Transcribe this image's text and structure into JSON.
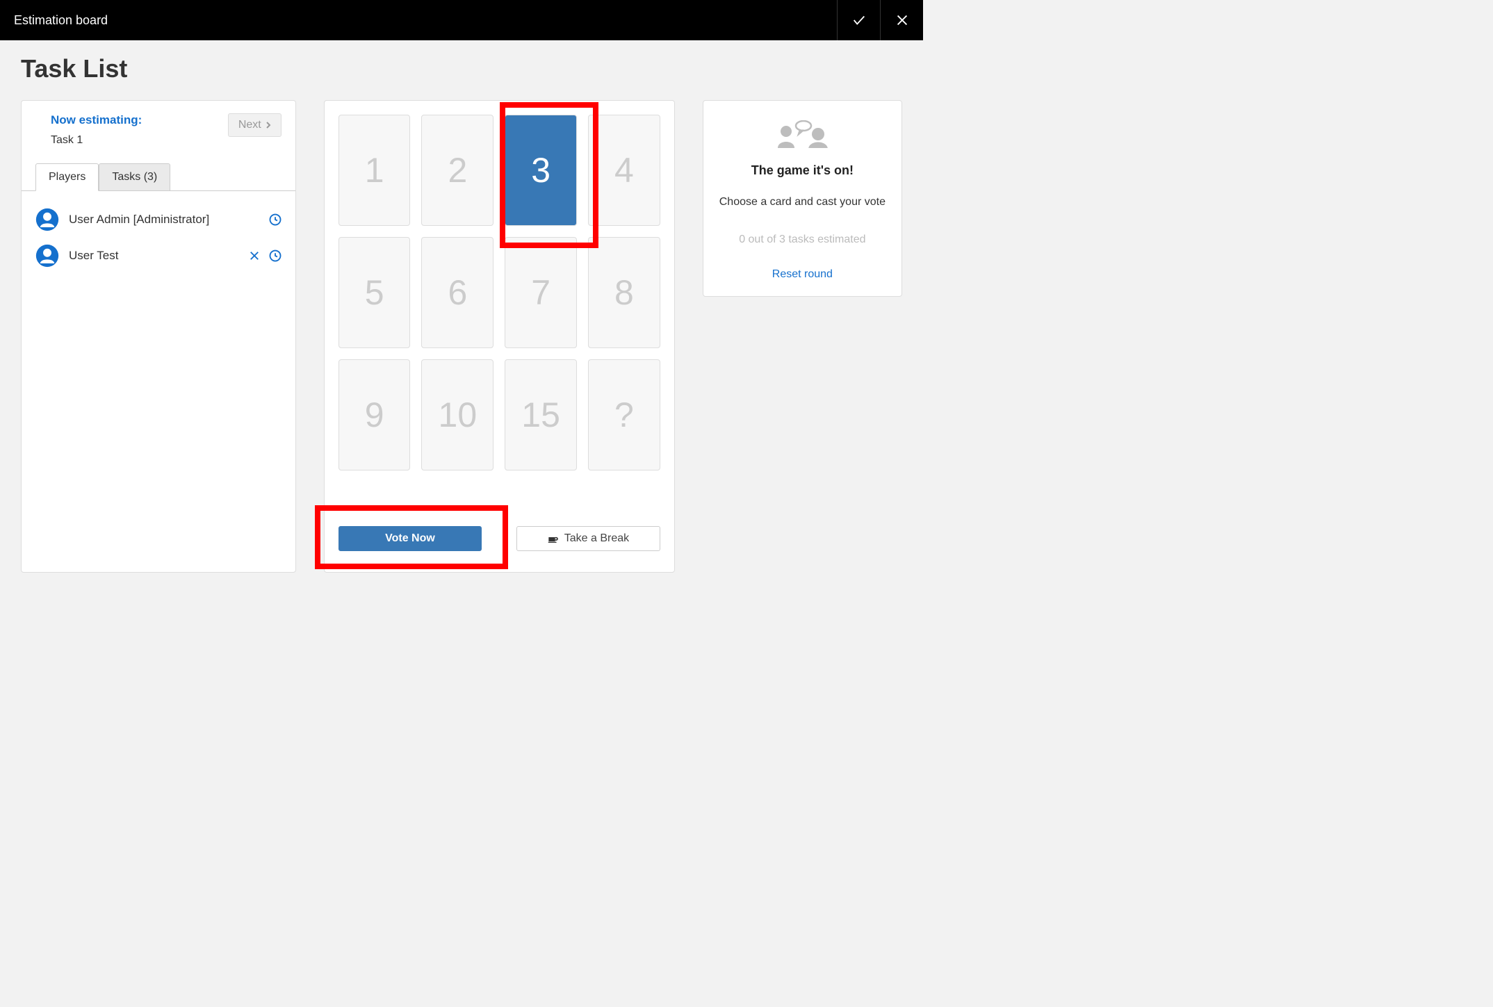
{
  "header": {
    "title": "Estimation board"
  },
  "page_title": "Task List",
  "left_panel": {
    "now_estimating_label": "Now estimating:",
    "current_task": "Task 1",
    "next_button": "Next",
    "tabs": {
      "players": "Players",
      "tasks": "Tasks (3)"
    },
    "players": [
      {
        "name": "User Admin [Administrator]",
        "removable": false
      },
      {
        "name": "User Test",
        "removable": true
      }
    ]
  },
  "cards": [
    "1",
    "2",
    "3",
    "4",
    "5",
    "6",
    "7",
    "8",
    "9",
    "10",
    "15",
    "?"
  ],
  "selected_card_index": 2,
  "center_buttons": {
    "vote": "Vote Now",
    "break": "Take a Break"
  },
  "right_panel": {
    "title": "The game it's on!",
    "subtitle": "Choose a card and cast your vote",
    "progress": "0 out of 3 tasks estimated",
    "reset": "Reset round"
  }
}
